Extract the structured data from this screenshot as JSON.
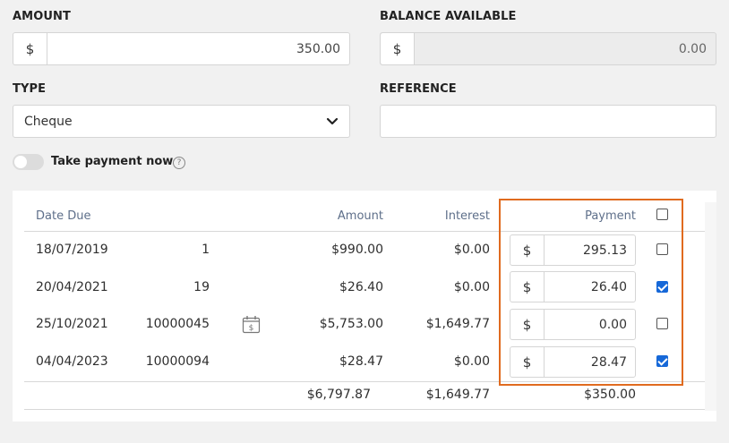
{
  "form": {
    "amount_label": "AMOUNT",
    "amount_currency": "$",
    "amount_value": "350.00",
    "balance_label": "BALANCE AVAILABLE",
    "balance_currency": "$",
    "balance_value": "0.00",
    "type_label": "TYPE",
    "type_value": "Cheque",
    "reference_label": "REFERENCE",
    "reference_value": "",
    "take_payment_label": "Take payment now",
    "take_payment_on": false,
    "help_icon": "?"
  },
  "table": {
    "headers": {
      "date_due": "Date Due",
      "amount": "Amount",
      "interest": "Interest",
      "payment": "Payment"
    },
    "header_checkbox_checked": false,
    "rows": [
      {
        "date": "18/07/2019",
        "ref": "1",
        "amount": "$990.00",
        "interest": "$0.00",
        "currency": "$",
        "payment": "295.13",
        "checked": false,
        "icon": ""
      },
      {
        "date": "20/04/2021",
        "ref": "19",
        "amount": "$26.40",
        "interest": "$0.00",
        "currency": "$",
        "payment": "26.40",
        "checked": true,
        "icon": ""
      },
      {
        "date": "25/10/2021",
        "ref": "10000045",
        "amount": "$5,753.00",
        "interest": "$1,649.77",
        "currency": "$",
        "payment": "0.00",
        "checked": false,
        "icon": "calendar-dollar-icon"
      },
      {
        "date": "04/04/2023",
        "ref": "10000094",
        "amount": "$28.47",
        "interest": "$0.00",
        "currency": "$",
        "payment": "28.47",
        "checked": true,
        "icon": ""
      }
    ],
    "totals": {
      "amount": "$6,797.87",
      "interest": "$1,649.77",
      "payment": "$350.00"
    }
  },
  "colors": {
    "highlight": "#e06b1f",
    "checkbox_on": "#1668d8",
    "header_text": "#5e6f8a"
  }
}
